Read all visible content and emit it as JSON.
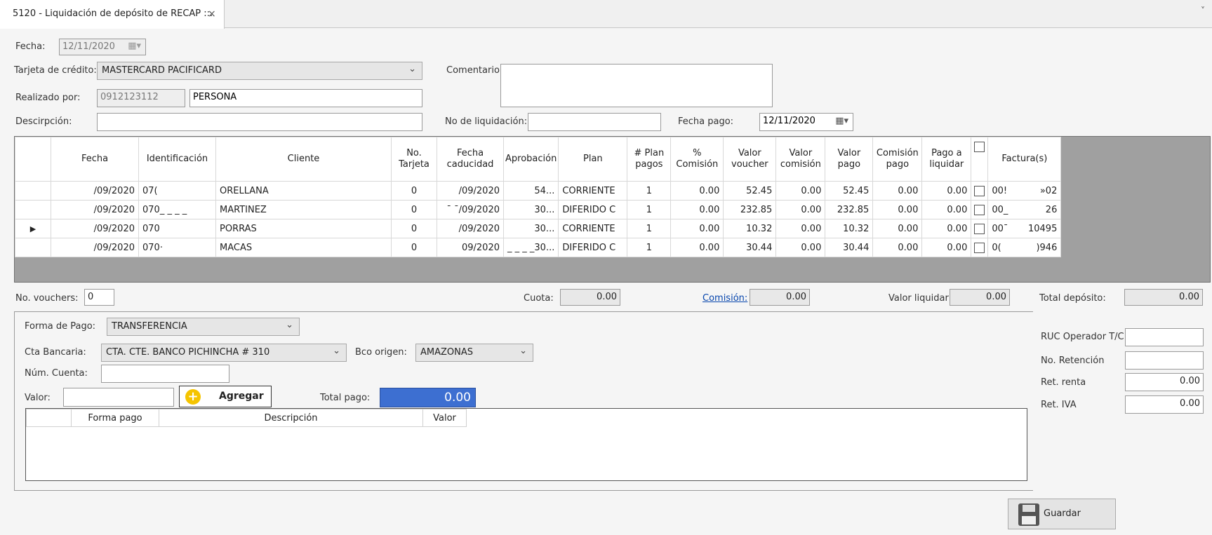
{
  "tab": {
    "title": "5120 - Liquidación de depósito de RECAP ::.",
    "close": "×",
    "menu": "˅"
  },
  "header": {
    "fecha_label": "Fecha:",
    "fecha_value": "12/11/2020",
    "tarjeta_label": "Tarjeta de crédito:",
    "tarjeta_value": "MASTERCARD PACIFICARD",
    "comentario_label": "Comentario:",
    "realizado_label": "Realizado por:",
    "realizado_id": "0912123112",
    "realizado_nombre": "PERSONA",
    "descripcion_label": "Descirpción:",
    "no_liquidacion_label": "No de liquidación:",
    "fecha_pago_label": "Fecha pago:",
    "fecha_pago_value": "12/11/2020"
  },
  "grid": {
    "columns": [
      "Fecha",
      "Identificación",
      "Cliente",
      "No.\nTarjeta",
      "Fecha\ncaducidad",
      "Aprobación",
      "Plan",
      "# Plan\npagos",
      "%\nComisión",
      "Valor\nvoucher",
      "Valor\ncomisión",
      "Valor\npago",
      "Comisión\npago",
      "Pago a\nliquidar",
      "",
      "Factura(s)"
    ],
    "rows": [
      {
        "marker": "",
        "fecha": "/09/2020",
        "id": "07(",
        "cliente": "ORELLANA",
        "tarjeta": "0",
        "caducidad": "/09/2020",
        "aprobacion": "54...",
        "plan": "CORRIENTE",
        "plan_pagos": "1",
        "comision_pct": "0.00",
        "voucher": "52.45",
        "comision": "0.00",
        "pago": "52.45",
        "comision_pago": "0.00",
        "liquidar": "0.00",
        "factura_a": "00!",
        "factura_b": "»02"
      },
      {
        "marker": "",
        "fecha": "/09/2020",
        "id": "070_ _ _ _",
        "cliente": "MARTINEZ",
        "tarjeta": "0",
        "caducidad": "¯ ¯/09/2020",
        "aprobacion": "30...",
        "plan": "DIFERIDO C",
        "plan_pagos": "1",
        "comision_pct": "0.00",
        "voucher": "232.85",
        "comision": "0.00",
        "pago": "232.85",
        "comision_pago": "0.00",
        "liquidar": "0.00",
        "factura_a": "00_",
        "factura_b": "26"
      },
      {
        "marker": "▶",
        "fecha": "/09/2020",
        "id": "070",
        "cliente": "PORRAS",
        "tarjeta": "0",
        "caducidad": "/09/2020",
        "aprobacion": "30...",
        "plan": "CORRIENTE",
        "plan_pagos": "1",
        "comision_pct": "0.00",
        "voucher": "10.32",
        "comision": "0.00",
        "pago": "10.32",
        "comision_pago": "0.00",
        "liquidar": "0.00",
        "factura_a": "00¯",
        "factura_b": "10495"
      },
      {
        "marker": "",
        "fecha": "/09/2020",
        "id": "070·",
        "cliente": "MACAS",
        "tarjeta": "0",
        "caducidad": "09/2020",
        "aprobacion": "_ _ _ _30...",
        "plan": "DIFERIDO C",
        "plan_pagos": "1",
        "comision_pct": "0.00",
        "voucher": "30.44",
        "comision": "0.00",
        "pago": "30.44",
        "comision_pago": "0.00",
        "liquidar": "0.00",
        "factura_a": "0(",
        "factura_b": ")946"
      }
    ]
  },
  "totals": {
    "vouchers_label": "No. vouchers:",
    "vouchers_value": "0",
    "cuota_label": "Cuota:",
    "cuota_value": "0.00",
    "comision_label": "Comisión:",
    "comision_value": "0.00",
    "valor_liquidar_label": "Valor liquidar:",
    "valor_liquidar_value": "0.00",
    "total_deposito_label": "Total depósito:",
    "total_deposito_value": "0.00"
  },
  "payment": {
    "forma_label": "Forma de Pago:",
    "forma_value": "TRANSFERENCIA",
    "cta_label": "Cta Bancaria:",
    "cta_value": "CTA. CTE. BANCO PICHINCHA # 310",
    "bco_label": "Bco origen:",
    "bco_value": "AMAZONAS",
    "num_cuenta_label": "Núm. Cuenta:",
    "valor_label": "Valor:",
    "agregar_label": "Agregar",
    "total_pago_label": "Total pago:",
    "total_pago_value": "0.00",
    "sub_columns": [
      "",
      "Forma pago",
      "Descripción",
      "Valor"
    ]
  },
  "retenciones": {
    "ruc_label": "RUC Operador T/C",
    "no_ret_label": "No. Retención",
    "ret_renta_label": "Ret. renta",
    "ret_renta_value": "0.00",
    "ret_iva_label": "Ret. IVA",
    "ret_iva_value": "0.00"
  },
  "actions": {
    "guardar_label": "Guardar"
  },
  "colors": {
    "accent_blue": "#3d6fd1",
    "grid_gray": "#a0a0a0",
    "link": "#0645ad",
    "plus_yellow": "#f5c400"
  }
}
